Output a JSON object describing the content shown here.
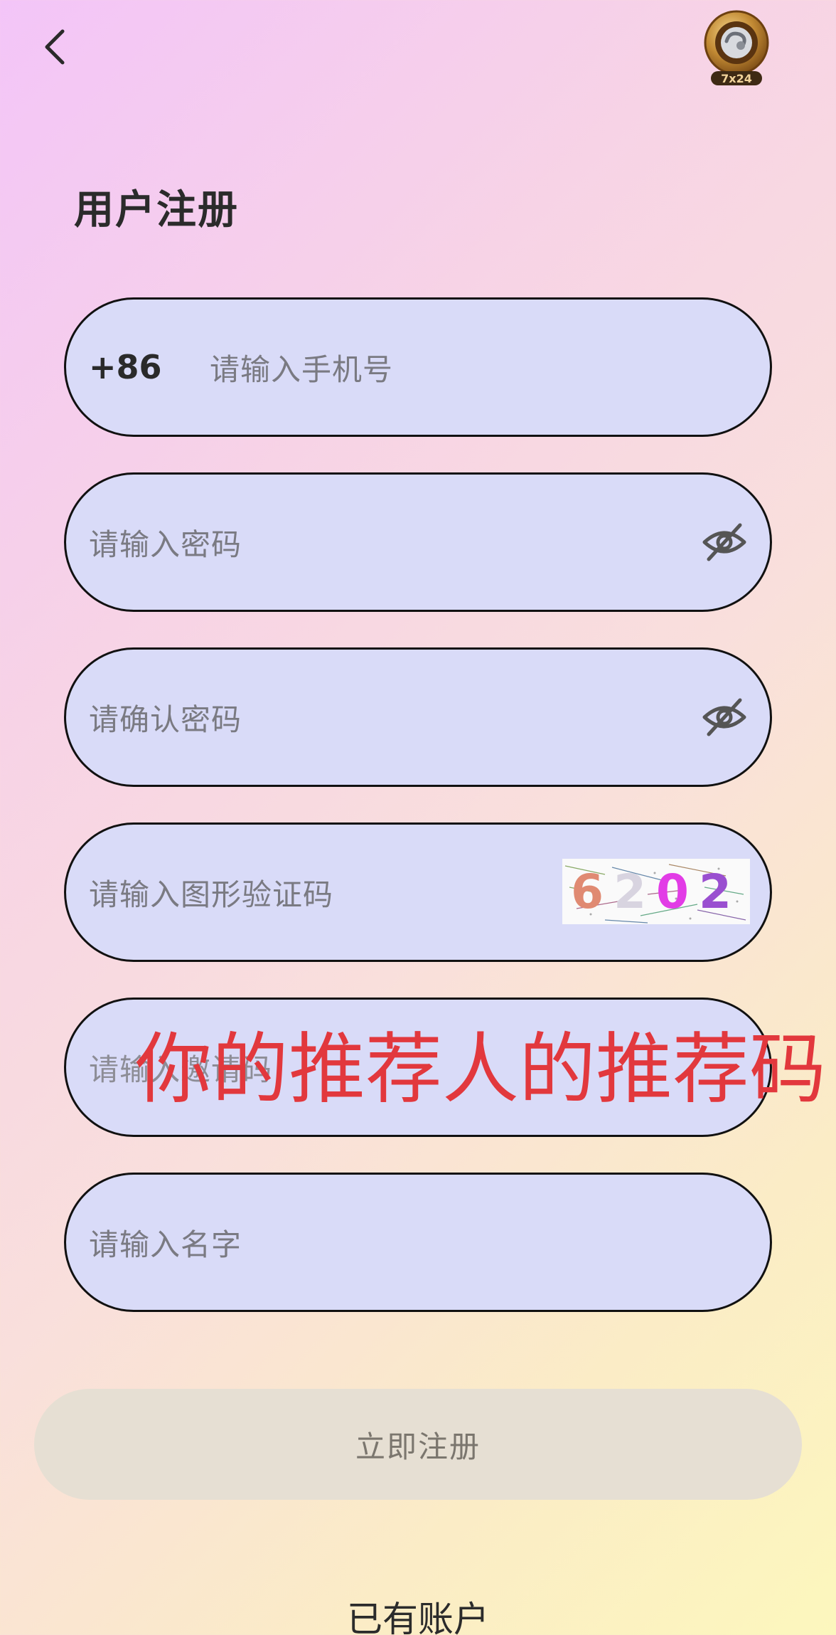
{
  "header": {
    "back_icon": "chevron-left-icon",
    "support_badge_label": "7x24",
    "support_icon": "customer-service-icon"
  },
  "title": "用户注册",
  "form": {
    "phone_prefix": "+86",
    "phone_placeholder": "请输入手机号",
    "password_placeholder": "请输入密码",
    "confirm_password_placeholder": "请确认密码",
    "captcha_placeholder": "请输入图形验证码",
    "captcha_code": [
      "6",
      "2",
      "0",
      "2"
    ],
    "invite_placeholder": "请输入邀请码",
    "name_placeholder": "请输入名字",
    "eye_icon": "eye-off-icon"
  },
  "annotation": {
    "text": "你的推荐人的推荐码",
    "color": "#e2383d"
  },
  "submit_label": "立即注册",
  "login_link": "已有账户",
  "colors": {
    "field_bg": "#d9dbf8",
    "submit_bg": "#e6dfd3",
    "badge_gold": "#b07a2a"
  }
}
